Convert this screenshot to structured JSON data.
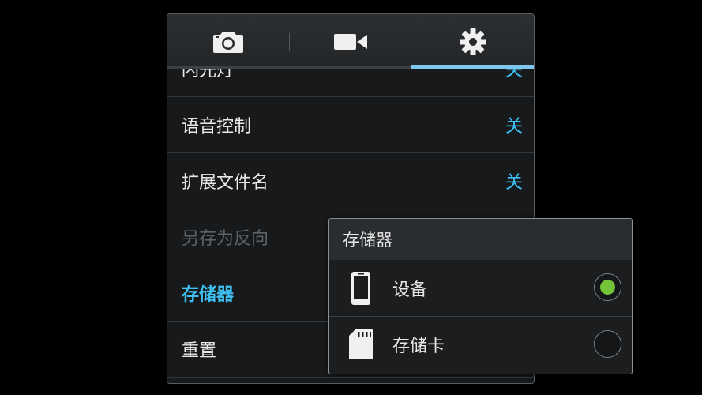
{
  "tabs": [
    {
      "name": "camera",
      "icon": "camera-icon",
      "active": false
    },
    {
      "name": "video",
      "icon": "video-camera-icon",
      "active": false
    },
    {
      "name": "settings",
      "icon": "gear-icon",
      "active": true
    }
  ],
  "settings": {
    "rows": [
      {
        "label": "闪光灯",
        "value": "关"
      },
      {
        "label": "语音控制",
        "value": "关"
      },
      {
        "label": "扩展文件名",
        "value": "关"
      },
      {
        "label": "另存为反向",
        "value": ""
      },
      {
        "label": "存储器",
        "value": ""
      },
      {
        "label": "重置",
        "value": ""
      }
    ]
  },
  "storage_dialog": {
    "title": "存储器",
    "options": [
      {
        "label": "设备",
        "icon": "phone-device-icon",
        "selected": true
      },
      {
        "label": "存储卡",
        "icon": "sd-card-icon",
        "selected": false
      }
    ]
  },
  "colors": {
    "accent": "#3ec0f2",
    "radio_selected": "#74c43a",
    "tab_indicator": "#7ec7ee"
  }
}
